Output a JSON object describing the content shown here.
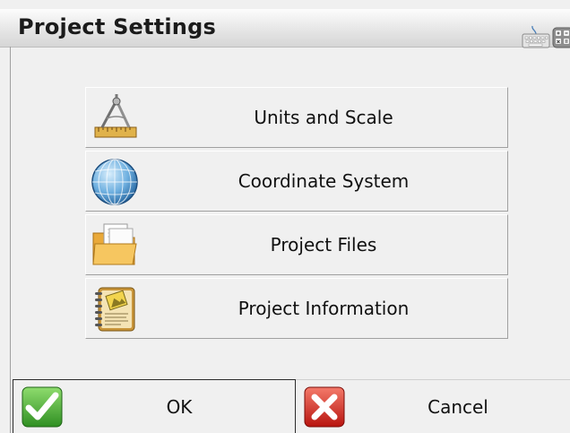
{
  "window": {
    "title": "Project Settings"
  },
  "header_icons": [
    "keyboard-icon",
    "calculator-icon"
  ],
  "menu": [
    {
      "label": "Units and Scale",
      "icon": "compass-ruler-icon"
    },
    {
      "label": "Coordinate System",
      "icon": "globe-icon"
    },
    {
      "label": "Project Files",
      "icon": "folder-icon"
    },
    {
      "label": "Project Information",
      "icon": "notebook-icon"
    }
  ],
  "actions": {
    "ok_label": "OK",
    "ok_icon": "green-check-icon",
    "cancel_label": "Cancel",
    "cancel_icon": "red-x-icon"
  },
  "colors": {
    "ok_green": "#3ea82d",
    "cancel_red": "#d8221e",
    "globe_blue": "#2f7fc4"
  }
}
